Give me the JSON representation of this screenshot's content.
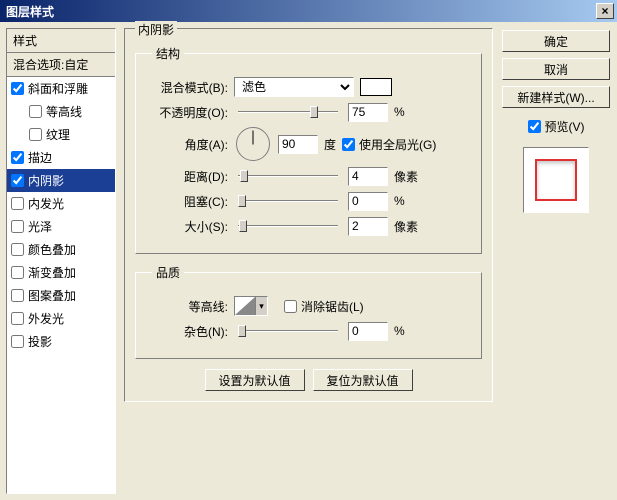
{
  "title": "图层样式",
  "sidebar": {
    "header": "样式",
    "blend_options": "混合选项:自定",
    "items": [
      {
        "label": "斜面和浮雕",
        "checked": true,
        "indent": 0,
        "selected": false
      },
      {
        "label": "等高线",
        "checked": false,
        "indent": 1,
        "selected": false
      },
      {
        "label": "纹理",
        "checked": false,
        "indent": 1,
        "selected": false
      },
      {
        "label": "描边",
        "checked": true,
        "indent": 0,
        "selected": false
      },
      {
        "label": "内阴影",
        "checked": true,
        "indent": 0,
        "selected": true
      },
      {
        "label": "内发光",
        "checked": false,
        "indent": 0,
        "selected": false
      },
      {
        "label": "光泽",
        "checked": false,
        "indent": 0,
        "selected": false
      },
      {
        "label": "颜色叠加",
        "checked": false,
        "indent": 0,
        "selected": false
      },
      {
        "label": "渐变叠加",
        "checked": false,
        "indent": 0,
        "selected": false
      },
      {
        "label": "图案叠加",
        "checked": false,
        "indent": 0,
        "selected": false
      },
      {
        "label": "外发光",
        "checked": false,
        "indent": 0,
        "selected": false
      },
      {
        "label": "投影",
        "checked": false,
        "indent": 0,
        "selected": false
      }
    ]
  },
  "panel": {
    "title": "内阴影",
    "structure": {
      "legend": "结构",
      "blend_mode_label": "混合模式(B):",
      "blend_mode_value": "滤色",
      "opacity_label": "不透明度(O):",
      "opacity_value": "75",
      "pct": "%",
      "angle_label": "角度(A):",
      "angle_value": "90",
      "degree": "度",
      "global_light_label": "使用全局光(G)",
      "distance_label": "距离(D):",
      "distance_value": "4",
      "px": "像素",
      "choke_label": "阻塞(C):",
      "choke_value": "0",
      "size_label": "大小(S):",
      "size_value": "2"
    },
    "quality": {
      "legend": "品质",
      "contour_label": "等高线:",
      "antialias_label": "消除锯齿(L)",
      "noise_label": "杂色(N):",
      "noise_value": "0",
      "pct": "%"
    },
    "buttons": {
      "reset_default": "设置为默认值",
      "restore_default": "复位为默认值"
    }
  },
  "right": {
    "ok": "确定",
    "cancel": "取消",
    "new_style": "新建样式(W)...",
    "preview_label": "预览(V)"
  }
}
